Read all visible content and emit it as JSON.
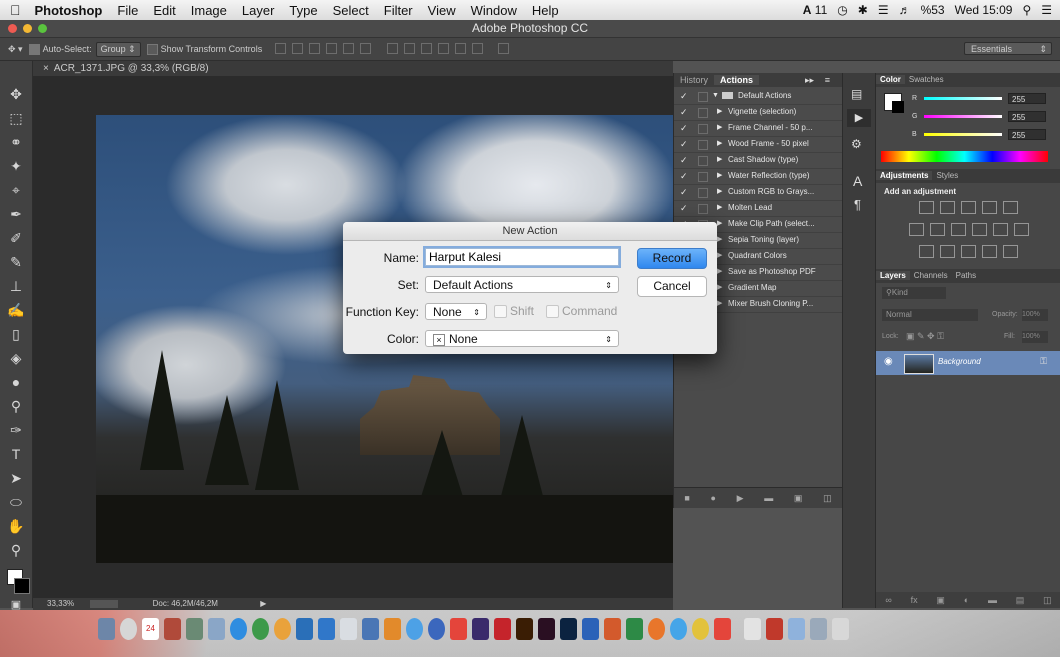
{
  "menubar": {
    "app_name": "Photoshop",
    "items": [
      "File",
      "Edit",
      "Image",
      "Layer",
      "Type",
      "Select",
      "Filter",
      "View",
      "Window",
      "Help"
    ],
    "status": {
      "adobe": "11",
      "battery": "%53",
      "clock": "Wed 15:09"
    }
  },
  "window": {
    "title": "Adobe Photoshop CC"
  },
  "options_bar": {
    "auto_select_label": "Auto-Select:",
    "auto_select_value": "Group",
    "show_transform_label": "Show Transform Controls",
    "workspace": "Essentials"
  },
  "document": {
    "tab_title": "ACR_1371.JPG @ 33,3% (RGB/8)",
    "zoom": "33,33%",
    "doc_size": "Doc: 46,2M/46,2M"
  },
  "actions_panel": {
    "tabs": [
      "History",
      "Actions"
    ],
    "set_name": "Default Actions",
    "items": [
      "Vignette (selection)",
      "Frame Channel - 50 p...",
      "Wood Frame - 50 pixel",
      "Cast Shadow (type)",
      "Water Reflection (type)",
      "Custom RGB to Grays...",
      "Molten Lead",
      "Make Clip Path (select...",
      "Sepia Toning (layer)",
      "Quadrant Colors",
      "Save as Photoshop PDF",
      "Gradient Map",
      "Mixer Brush Cloning P..."
    ]
  },
  "color_panel": {
    "tabs": [
      "Color",
      "Swatches"
    ],
    "r_label": "R",
    "g_label": "G",
    "b_label": "B",
    "r": "255",
    "g": "255",
    "b": "255"
  },
  "adjustments_panel": {
    "tabs": [
      "Adjustments",
      "Styles"
    ],
    "heading": "Add an adjustment"
  },
  "layers_panel": {
    "tabs": [
      "Layers",
      "Channels",
      "Paths"
    ],
    "kind": "Kind",
    "blend_mode": "Normal",
    "opacity_label": "Opacity:",
    "opacity": "100%",
    "lock_label": "Lock:",
    "fill_label": "Fill:",
    "fill": "100%",
    "layer_name": "Background"
  },
  "dialog": {
    "title": "New Action",
    "name_label": "Name:",
    "name_value": "Harput Kalesi",
    "set_label": "Set:",
    "set_value": "Default Actions",
    "fkey_label": "Function Key:",
    "fkey_value": "None",
    "shift_label": "Shift",
    "command_label": "Command",
    "color_label": "Color:",
    "color_value": "None",
    "record_label": "Record",
    "cancel_label": "Cancel"
  },
  "dock": {
    "calendar_day": "24"
  },
  "colors": {
    "accent": "#3b8ce8",
    "panel_bg": "#474747",
    "dialog_bg": "#ececec"
  }
}
